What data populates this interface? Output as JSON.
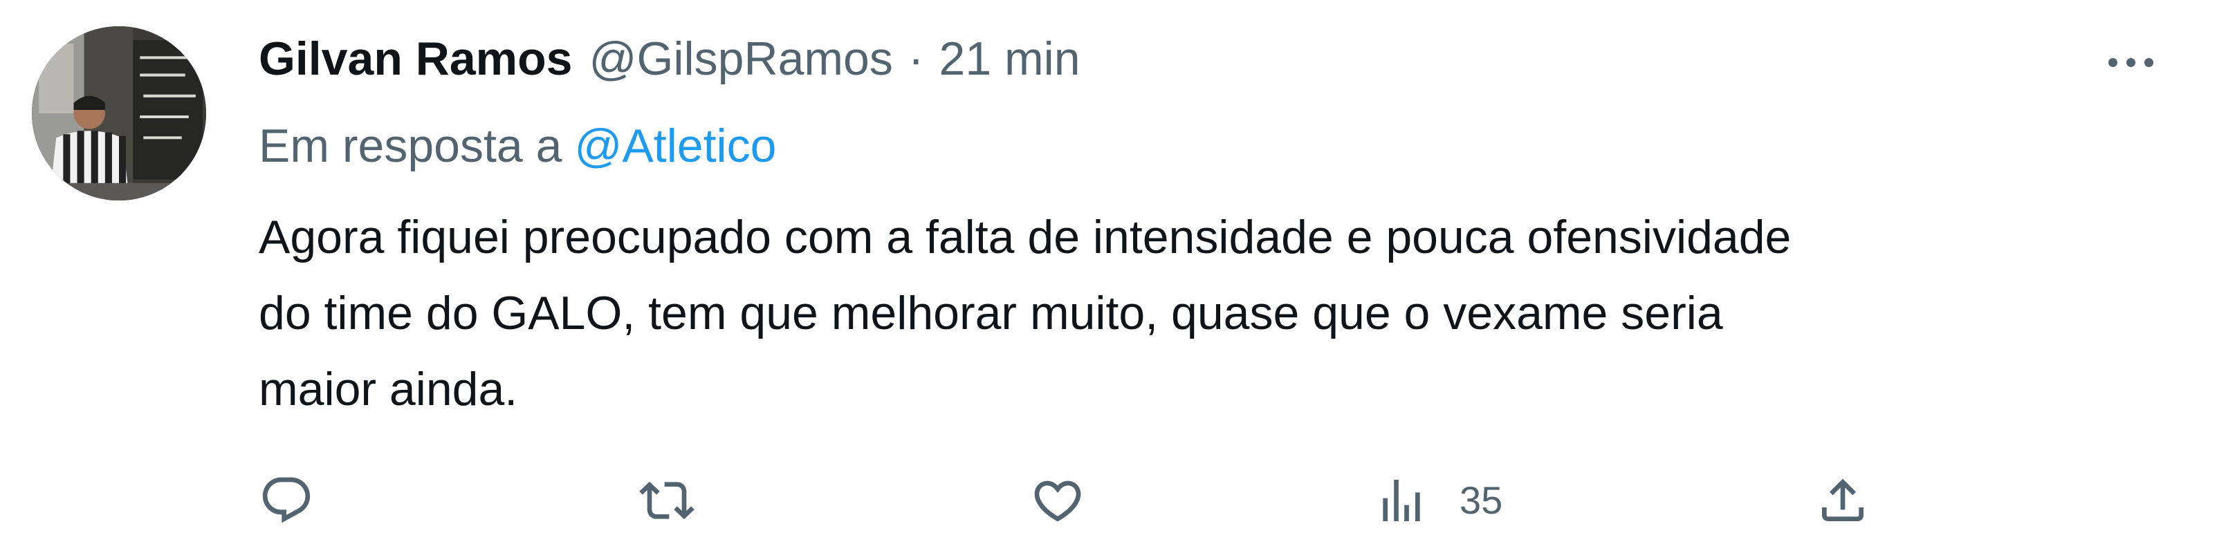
{
  "tweet": {
    "author": {
      "display_name": "Gilvan Ramos",
      "handle": "@GilspRamos",
      "separator": "·",
      "time": "21 min"
    },
    "reply_to": {
      "prefix": "Em resposta a",
      "mention": "@Atletico"
    },
    "text_lines": [
      "Agora fiquei preocupado com a falta de intensidade e pouca ofensividade",
      "do time do GALO, tem que melhorar muito, quase que o vexame seria",
      "maior ainda."
    ],
    "actions": {
      "reply_icon": "reply-icon",
      "retweet_icon": "retweet-icon",
      "like_icon": "heart-icon",
      "views_icon": "views-chart-icon",
      "views_count": "35",
      "share_icon": "share-upload-icon"
    },
    "more_icon": "more-dots-icon"
  },
  "colors": {
    "text": "#0f1419",
    "muted": "#536471",
    "accent": "#1d9bf0",
    "background": "#ffffff"
  }
}
